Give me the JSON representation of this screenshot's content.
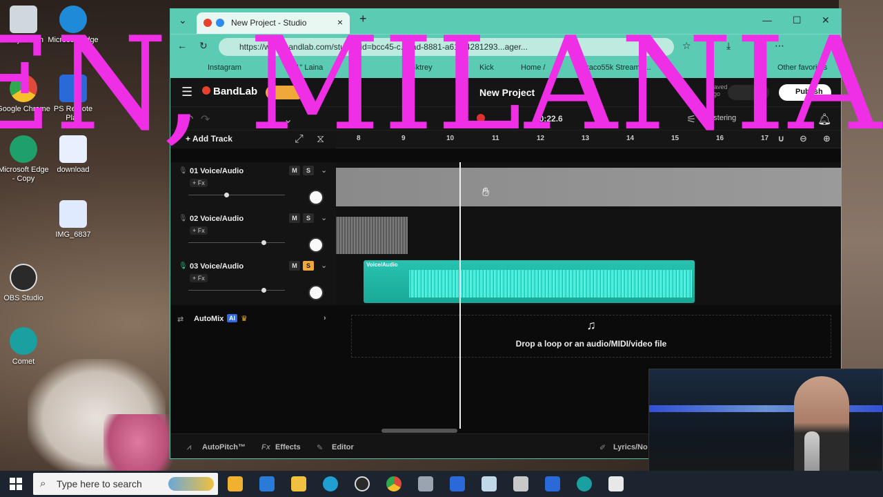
{
  "desktop": {
    "icons": [
      {
        "label": "Recycle Bin",
        "color": "#cfd8dc"
      },
      {
        "label": "Microsoft Edge",
        "color": "#1f8ad8"
      },
      {
        "label": "Google Chrome",
        "color": "#e04a3a"
      },
      {
        "label": "PS Remote Play",
        "color": "#2a6ad8"
      },
      {
        "label": "Microsoft Edge - Copy",
        "color": "#1fa06a"
      },
      {
        "label": "download",
        "color": "#e8f0ff"
      },
      {
        "label": "IMG_6837",
        "color": "#dfeaff"
      },
      {
        "label": "OBS Studio",
        "color": "#2a2a2a"
      },
      {
        "label": "Comet",
        "color": "#1aa0a0"
      }
    ]
  },
  "browser": {
    "tab_title": "New Project - Studio",
    "url": "https://www.bandlab.com/studio?id=bcc45-c...cad-8881-a61f34281293...ager...",
    "bookmarks": [
      "Instagram",
      "11\" Laina",
      "sb4ktrey",
      "Kick",
      "Home /",
      "fraco55k Stream -...",
      "Other favorites"
    ]
  },
  "app": {
    "brand": "BandLab",
    "project_title": "New Project",
    "time": "00:22.6",
    "add_track": "Add Track",
    "saved_label": "Saved ago",
    "publish": "Publish",
    "mastering": "Mastering",
    "ruler": [
      "8",
      "9",
      "10",
      "11",
      "12",
      "13",
      "14",
      "15",
      "16",
      "17"
    ],
    "tracks": [
      {
        "name": "01  Voice/Audio",
        "fx": "+ Fx",
        "m": "M",
        "s": "S",
        "solo": false,
        "fader": 0.38
      },
      {
        "name": "02  Voice/Audio",
        "fx": "+ Fx",
        "m": "M",
        "s": "S",
        "solo": false,
        "fader": 0.77
      },
      {
        "name": "03  Voice/Audio",
        "fx": "+ Fx",
        "m": "M",
        "s": "S",
        "solo": true,
        "fader": 0.77
      }
    ],
    "clip_label": "Voice/Audio",
    "automix": "AutoMix",
    "automix_ai": "AI",
    "drop_text": "Drop a loop or an audio/MIDI/video file",
    "bottom": {
      "autopitch": "AutoPitch™",
      "effects": "Effects",
      "editor": "Editor",
      "lyrics": "Lyrics/No"
    }
  },
  "overlay": {
    "text": "EN, MILANIA"
  },
  "taskbar": {
    "search_placeholder": "Type here to search"
  }
}
